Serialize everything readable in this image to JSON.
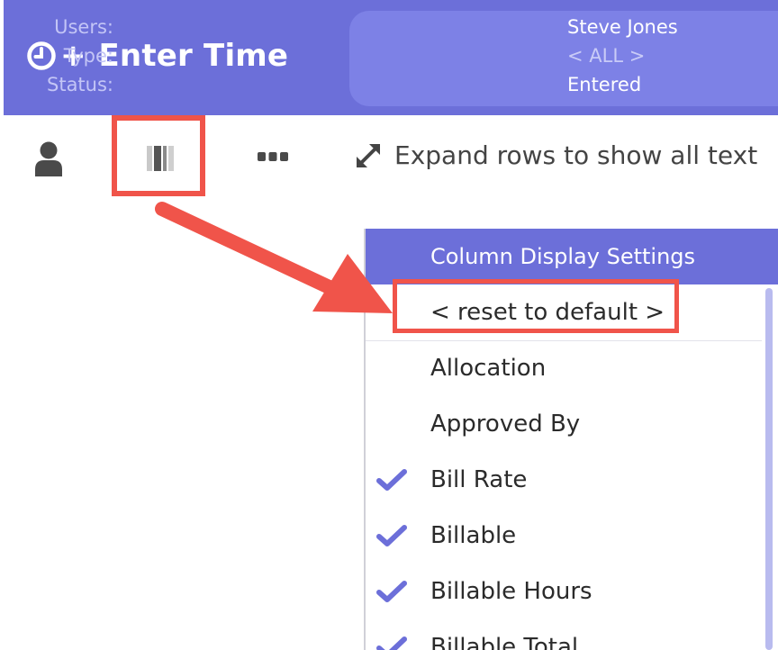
{
  "header": {
    "title": "Enter Time",
    "plus": "+",
    "filters": [
      {
        "label": "Users:",
        "value": "Steve Jones",
        "dim": false
      },
      {
        "label": "Type:",
        "value": "< ALL >",
        "dim": true
      },
      {
        "label": "Status:",
        "value": "Entered",
        "dim": false
      }
    ]
  },
  "toolbar": {
    "expand_label": "Expand rows to show all text",
    "icons": [
      "user-icon",
      "columns-icon",
      "more-icon",
      "expand-icon"
    ]
  },
  "column_menu": {
    "title": "Column Display Settings",
    "reset_label": "< reset to default >",
    "items": [
      {
        "label": "Allocation",
        "checked": false
      },
      {
        "label": "Approved By",
        "checked": false
      },
      {
        "label": "Bill Rate",
        "checked": true
      },
      {
        "label": "Billable",
        "checked": true
      },
      {
        "label": "Billable Hours",
        "checked": true
      },
      {
        "label": "Billable Total",
        "checked": true
      }
    ]
  },
  "colors": {
    "brand": "#6c6fd9",
    "filter_panel": "#7d81e6",
    "highlight": "#f0544a",
    "check": "#6c6fd9"
  }
}
